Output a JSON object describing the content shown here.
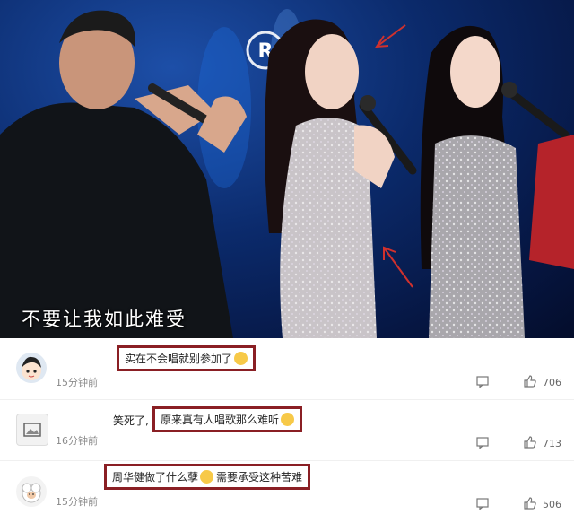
{
  "video": {
    "subtitle": "不要让我如此难受"
  },
  "comments": [
    {
      "time": "15分钟前",
      "prefix": "",
      "text": "实在不会唱就别参加了",
      "emoji": "sweat-smile-emoji",
      "likes": "706"
    },
    {
      "time": "16分钟前",
      "prefix": "笑死了,",
      "text": "原来真有人唱歌那么难听",
      "emoji": "laugh-cry-emoji",
      "likes": "713"
    },
    {
      "time": "15分钟前",
      "prefix": "",
      "text_before": "周华健做了什么孽",
      "emoji": "awkward-smile-emoji",
      "text_after": "需要承受这种苦难",
      "likes": "506"
    }
  ],
  "icons": {
    "comment": "comment-icon",
    "like": "thumbs-up-icon"
  },
  "colors": {
    "highlight_border": "#8a1f24",
    "arrow": "#d0312d"
  }
}
